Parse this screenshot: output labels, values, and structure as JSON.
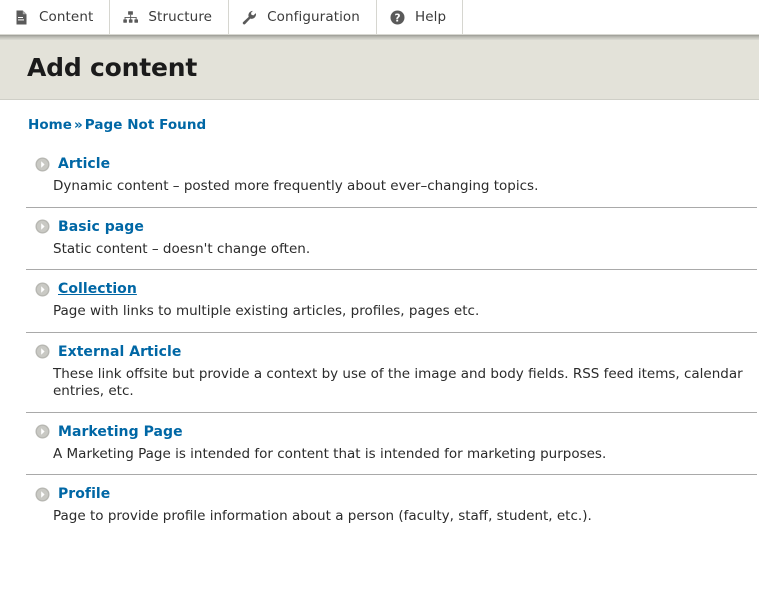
{
  "toolbar": {
    "tabs": [
      {
        "label": "Content",
        "icon": "document-icon"
      },
      {
        "label": "Structure",
        "icon": "hierarchy-icon"
      },
      {
        "label": "Configuration",
        "icon": "wrench-icon"
      },
      {
        "label": "Help",
        "icon": "question-circle-icon"
      }
    ]
  },
  "page": {
    "title": "Add content"
  },
  "breadcrumb": {
    "items": [
      {
        "label": "Home"
      },
      {
        "label": "Page Not Found"
      }
    ],
    "separator": "»"
  },
  "content_types": [
    {
      "title": "Article",
      "description": "Dynamic content – posted more frequently about ever–changing topics.",
      "hovered": false
    },
    {
      "title": "Basic page",
      "description": "Static content – doesn't change often.",
      "hovered": false
    },
    {
      "title": "Collection",
      "description": "Page with links to multiple existing articles, profiles, pages etc.",
      "hovered": true
    },
    {
      "title": "External Article",
      "description": "These link offsite but provide a context by use of the image and body fields. RSS feed items, calendar entries, etc.",
      "hovered": false
    },
    {
      "title": "Marketing Page",
      "description": "A Marketing Page is intended for content that is intended for marketing purposes.",
      "hovered": false
    },
    {
      "title": "Profile",
      "description": "Page to provide profile information about a person (faculty, staff, student, etc.).",
      "hovered": false
    }
  ],
  "colors": {
    "link": "#0067a5",
    "title_band": "#e3e2d9",
    "icon_gray": "#5a5a5a",
    "bullet_gray": "#b5b5b0",
    "separator": "#a9a9a9"
  }
}
